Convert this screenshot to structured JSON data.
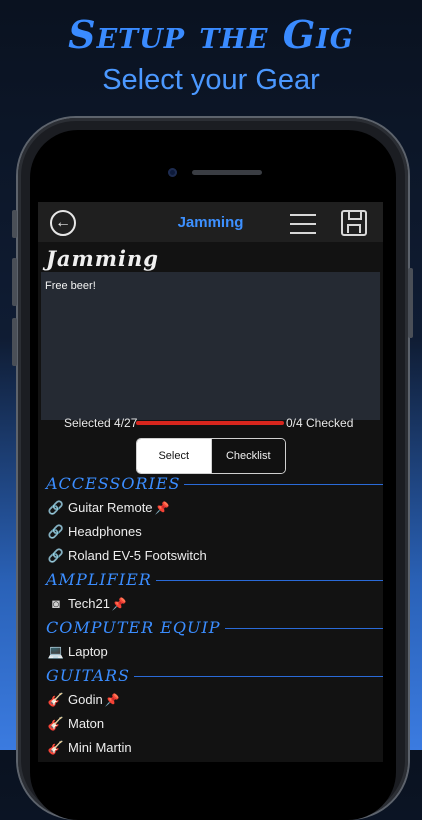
{
  "promo": {
    "headline": "Setup the Gig",
    "subheadline": "Select your Gear"
  },
  "navbar": {
    "back_icon": "back-arrow-circle-icon",
    "title": "Jamming",
    "menu_icon": "hamburger-menu-icon",
    "save_icon": "floppy-save-icon"
  },
  "gig": {
    "title": "Jamming",
    "notes": "Free beer!"
  },
  "status": {
    "selected_text": "Selected 4/27",
    "checked_text": "0/4 Checked",
    "progress": 0,
    "progress_color": "#d8261d"
  },
  "segments": {
    "select_label": "Select",
    "checklist_label": "Checklist",
    "active": "Select"
  },
  "sections": [
    {
      "title": "ACCESSORIES",
      "items": [
        {
          "label": "Guitar Remote",
          "icon": "cable-icon",
          "glyph": "🔗",
          "pinned": true
        },
        {
          "label": "Headphones",
          "icon": "cable-icon",
          "glyph": "🔗",
          "pinned": false
        },
        {
          "label": "Roland EV-5 Footswitch",
          "icon": "cable-icon",
          "glyph": "🔗",
          "pinned": false
        }
      ]
    },
    {
      "title": "AMPLIFIER",
      "items": [
        {
          "label": "Tech21",
          "icon": "speaker-icon",
          "glyph": "◙",
          "pinned": true
        }
      ]
    },
    {
      "title": "COMPUTER EQUIP",
      "items": [
        {
          "label": "Laptop",
          "icon": "laptop-icon",
          "glyph": "💻",
          "pinned": false
        }
      ]
    },
    {
      "title": "GUITARS",
      "items": [
        {
          "label": "Godin",
          "icon": "guitar-icon",
          "glyph": "🎸",
          "pinned": true
        },
        {
          "label": "Maton",
          "icon": "guitar-icon",
          "glyph": "🎸",
          "pinned": false
        },
        {
          "label": "Mini Martin",
          "icon": "guitar-icon",
          "glyph": "🎸",
          "pinned": false
        }
      ]
    }
  ],
  "pin_glyph": "📌",
  "colors": {
    "accent": "#3b8dff",
    "background": "#121212",
    "notes_bg": "#252a33"
  }
}
